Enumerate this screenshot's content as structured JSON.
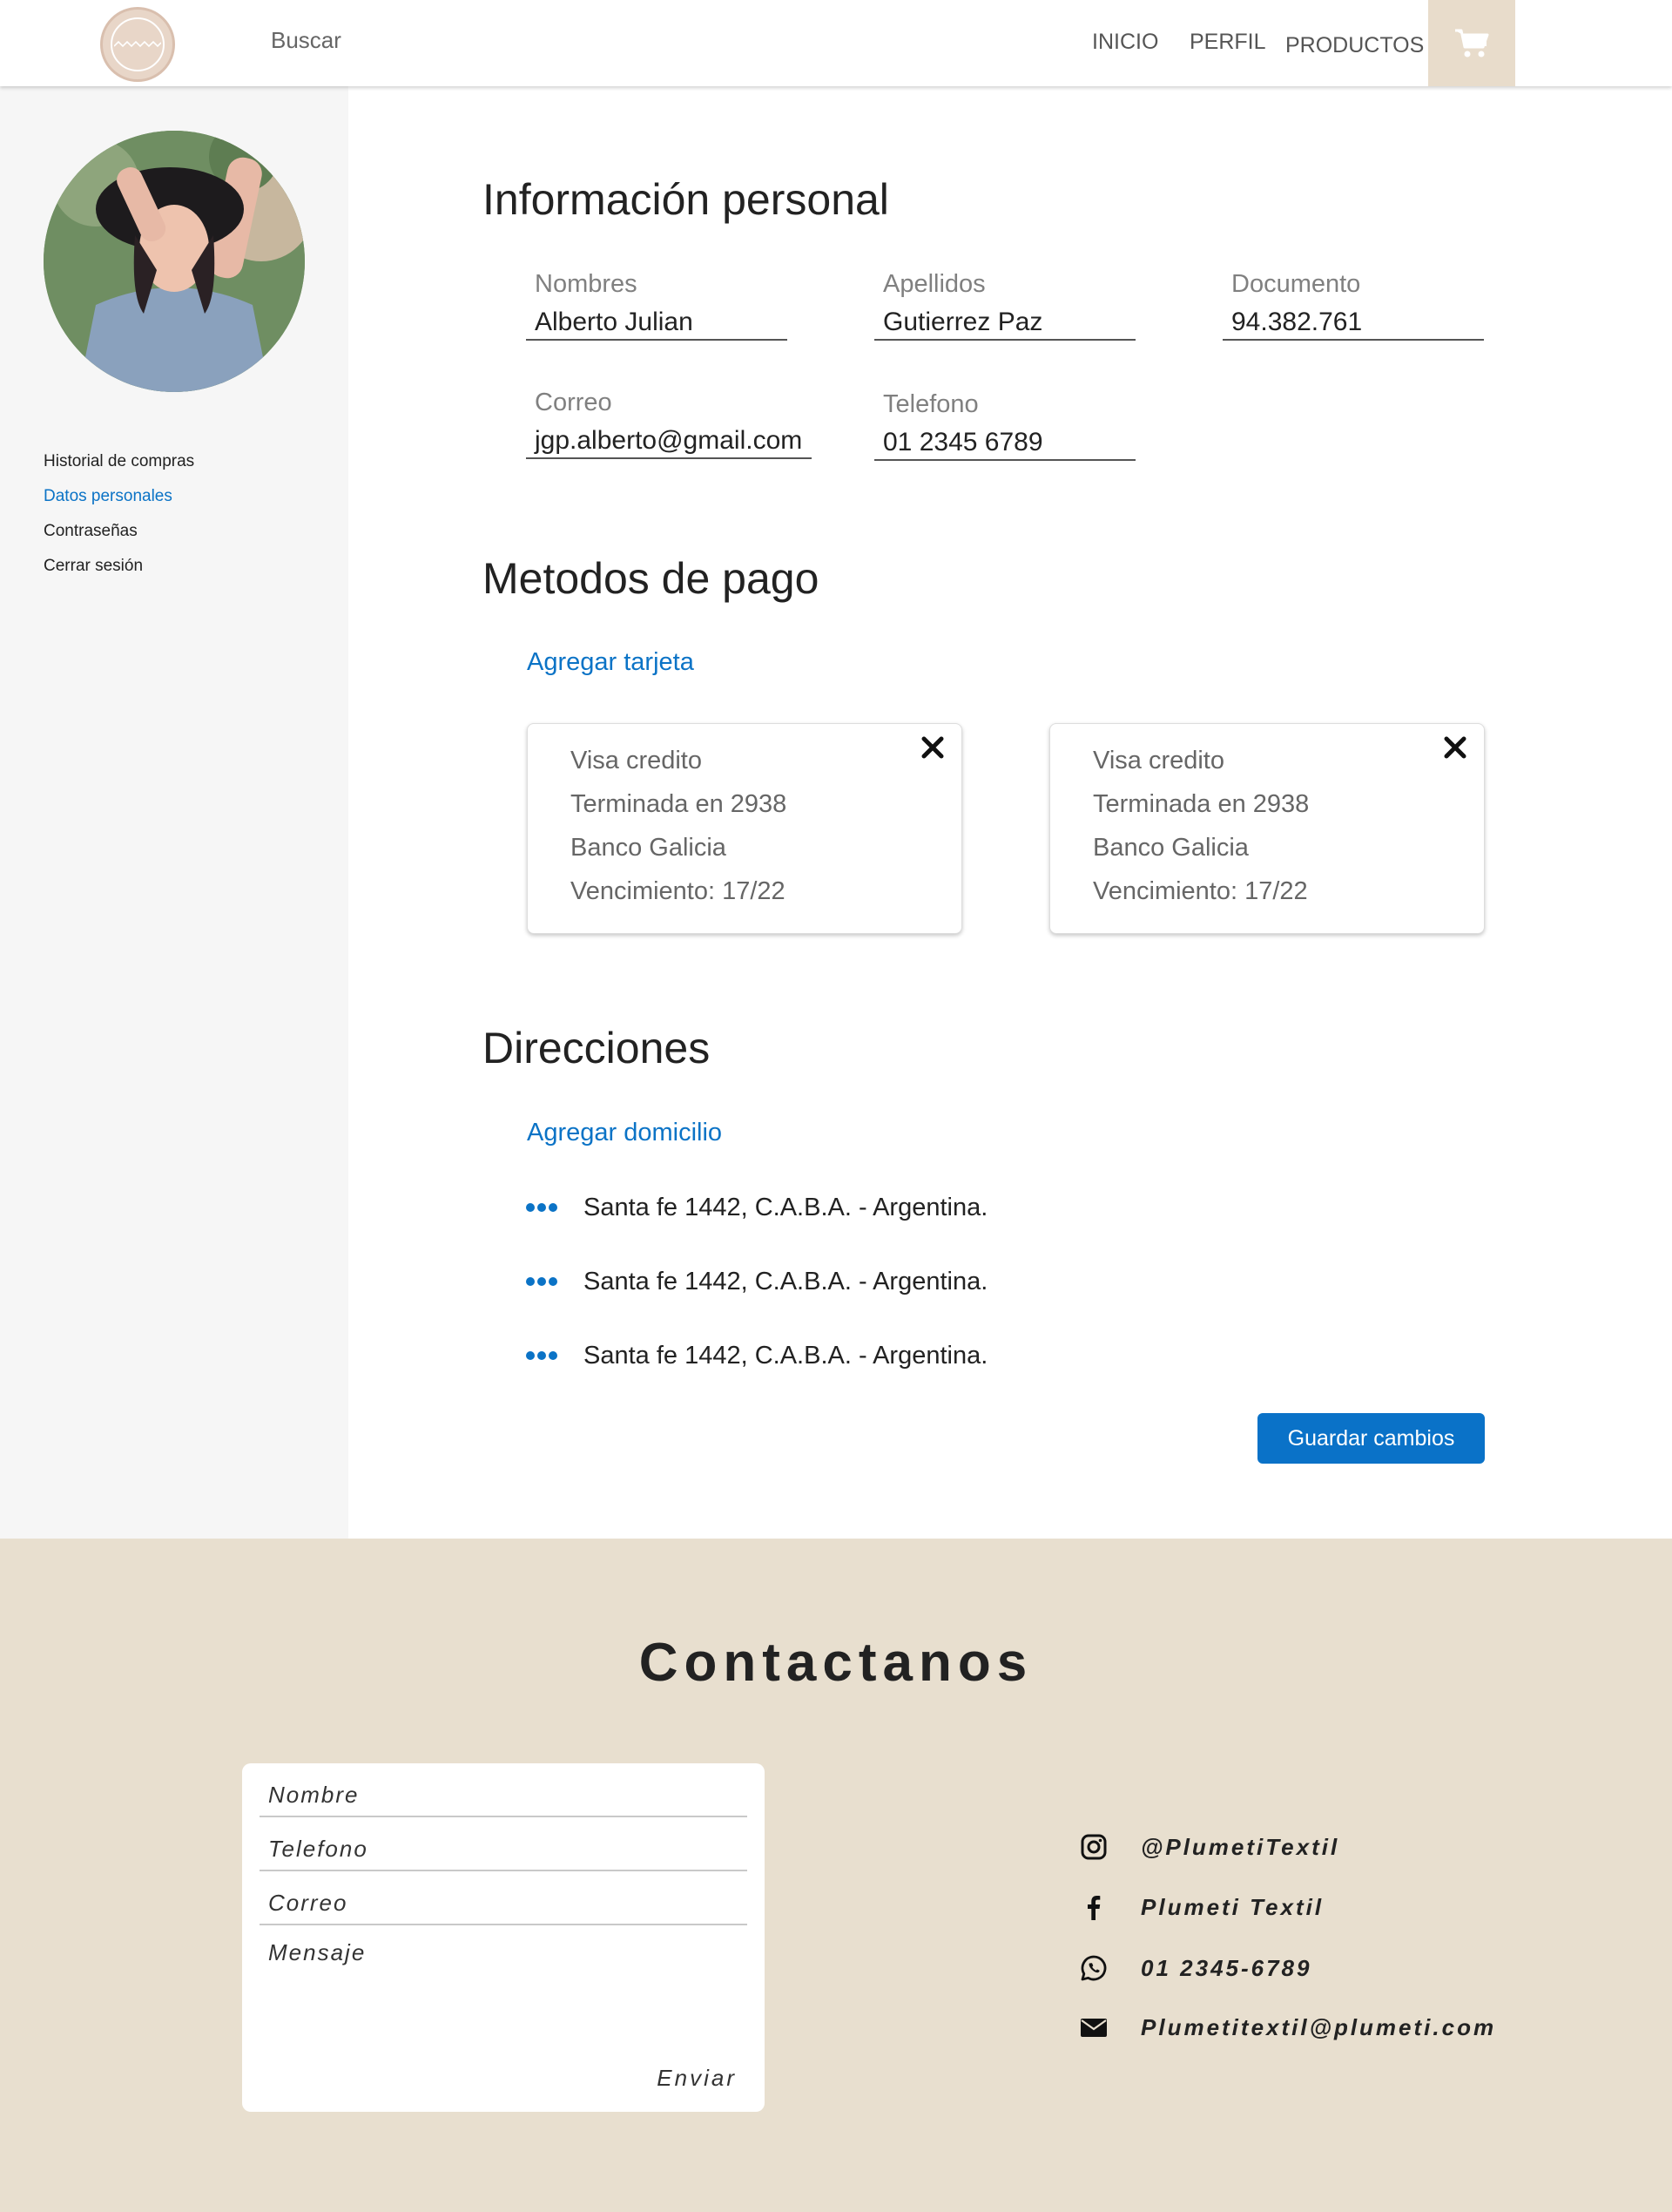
{
  "header": {
    "search_placeholder": "Buscar",
    "nav": {
      "inicio": "INICIO",
      "perfil": "PERFIL",
      "productos": "PRODUCTOS"
    }
  },
  "sidebar": {
    "items": [
      {
        "label": "Historial de compras",
        "active": false
      },
      {
        "label": "Datos personales",
        "active": true
      },
      {
        "label": "Contraseñas",
        "active": false
      },
      {
        "label": "Cerrar sesión",
        "active": false
      }
    ]
  },
  "personal": {
    "title": "Información personal",
    "fields": {
      "nombres": {
        "label": "Nombres",
        "value": "Alberto Julian"
      },
      "apellidos": {
        "label": "Apellidos",
        "value": "Gutierrez Paz"
      },
      "documento": {
        "label": "Documento",
        "value": "94.382.761"
      },
      "correo": {
        "label": "Correo",
        "value": "jgp.alberto@gmail.com"
      },
      "telefono": {
        "label": "Telefono",
        "value": "01 2345 6789"
      }
    }
  },
  "payment": {
    "title": "Metodos de pago",
    "add_label": "Agregar tarjeta",
    "cards": [
      {
        "type": "Visa credito",
        "ending": "Terminada en 2938",
        "bank": "Banco Galicia",
        "expiry": "Vencimiento: 17/22"
      },
      {
        "type": "Visa credito",
        "ending": "Terminada en 2938",
        "bank": "Banco Galicia",
        "expiry": "Vencimiento: 17/22"
      }
    ]
  },
  "addresses": {
    "title": "Direcciones",
    "add_label": "Agregar domicilio",
    "items": [
      "Santa fe 1442, C.A.B.A. - Argentina.",
      "Santa fe 1442, C.A.B.A. - Argentina.",
      "Santa fe 1442, C.A.B.A. - Argentina."
    ]
  },
  "save_label": "Guardar cambios",
  "footer": {
    "title": "Contactanos",
    "form": {
      "nombre": "Nombre",
      "telefono": "Telefono",
      "correo": "Correo",
      "mensaje": "Mensaje",
      "send": "Enviar"
    },
    "contacts": [
      {
        "icon": "instagram-icon",
        "text": "@PlumetiTextil"
      },
      {
        "icon": "facebook-icon",
        "text": "Plumeti Textil"
      },
      {
        "icon": "whatsapp-icon",
        "text": "01 2345-6789"
      },
      {
        "icon": "mail-icon",
        "text": "Plumetitextil@plumeti.com"
      }
    ]
  },
  "colors": {
    "accent": "#0b73c6",
    "footer_bg": "#e8dfcf",
    "sidebar_bg": "#f6f6f6",
    "cart_bg": "#e8dccb"
  }
}
